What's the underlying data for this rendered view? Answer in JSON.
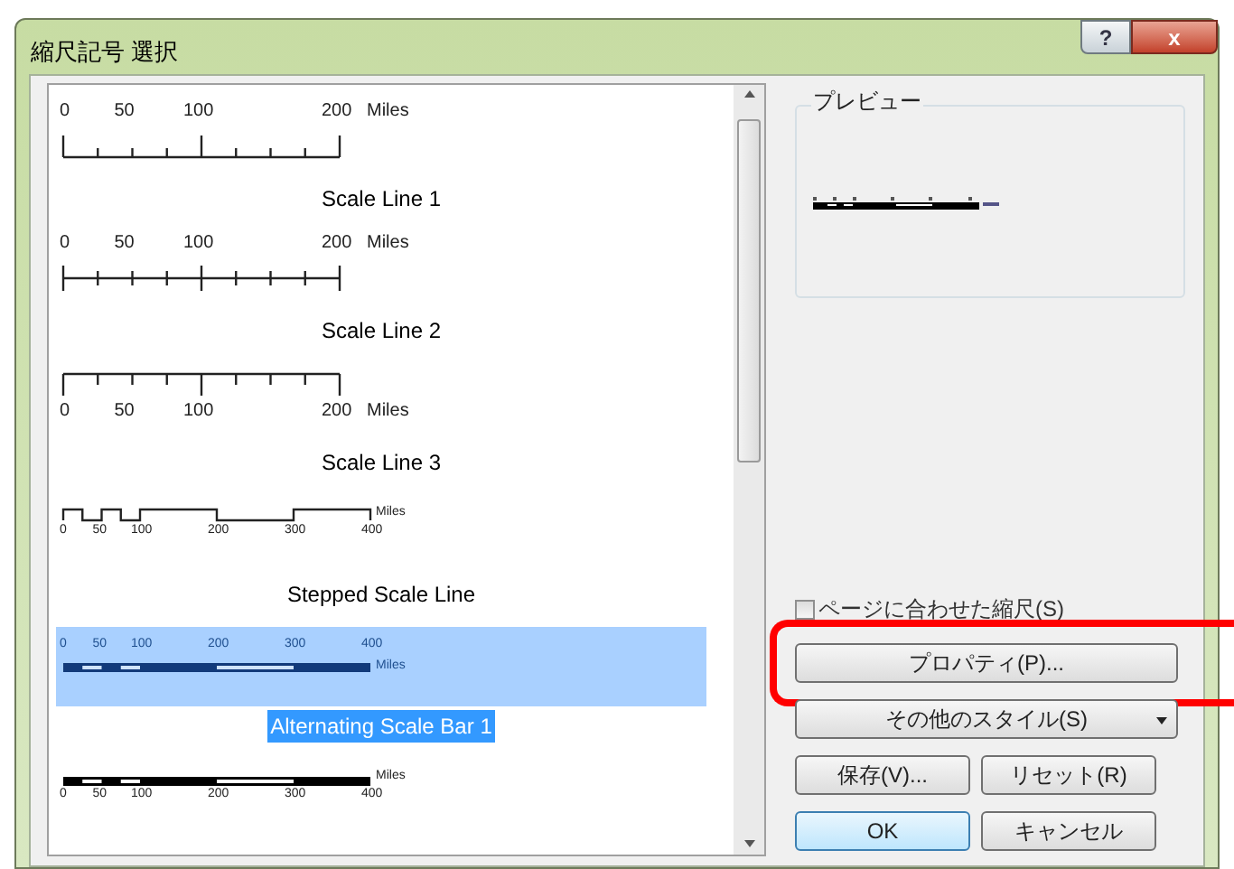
{
  "window": {
    "title": "縮尺記号 選択",
    "help_button": "?",
    "close_button": "x"
  },
  "styles": [
    {
      "kind": "line_down",
      "label": "Scale Line 1",
      "ticks": [
        "0",
        "50",
        "100",
        "200"
      ],
      "unit": "Miles",
      "selected": false
    },
    {
      "kind": "line_mid",
      "label": "Scale Line 2",
      "ticks": [
        "0",
        "50",
        "100",
        "200"
      ],
      "unit": "Miles",
      "selected": false
    },
    {
      "kind": "line_up",
      "label": "Scale Line 3",
      "ticks": [
        "0",
        "50",
        "100",
        "200"
      ],
      "unit": "Miles",
      "selected": false
    },
    {
      "kind": "stepped",
      "label": "Stepped Scale Line",
      "ticks": [
        "0",
        "50",
        "100",
        "200",
        "300",
        "400"
      ],
      "unit": "Miles",
      "selected": false
    },
    {
      "kind": "alternating",
      "label": "Alternating Scale Bar 1",
      "ticks": [
        "0",
        "50",
        "100",
        "200",
        "300",
        "400"
      ],
      "unit": "Miles",
      "selected": true
    },
    {
      "kind": "bar",
      "ticks": [
        "0",
        "50",
        "100",
        "200",
        "300",
        "400"
      ],
      "unit": "Miles",
      "selected": false
    }
  ],
  "preview": {
    "title": "プレビュー"
  },
  "fit_to_page": {
    "label": "ページに合わせた縮尺(S)",
    "checked": false
  },
  "buttons": [
    {
      "kind": "wide",
      "label": "プロパティ(P)...",
      "highlighted": true
    },
    {
      "kind": "dropdown",
      "label": "その他のスタイル(S)",
      "highlighted": false
    },
    {
      "kind": "half",
      "label": "保存(V)...",
      "highlighted": false
    },
    {
      "kind": "half",
      "label": "リセット(R)",
      "highlighted": false
    },
    {
      "kind": "default",
      "label": "OK",
      "highlighted": false
    },
    {
      "kind": "half",
      "label": "キャンセル",
      "highlighted": false
    }
  ]
}
